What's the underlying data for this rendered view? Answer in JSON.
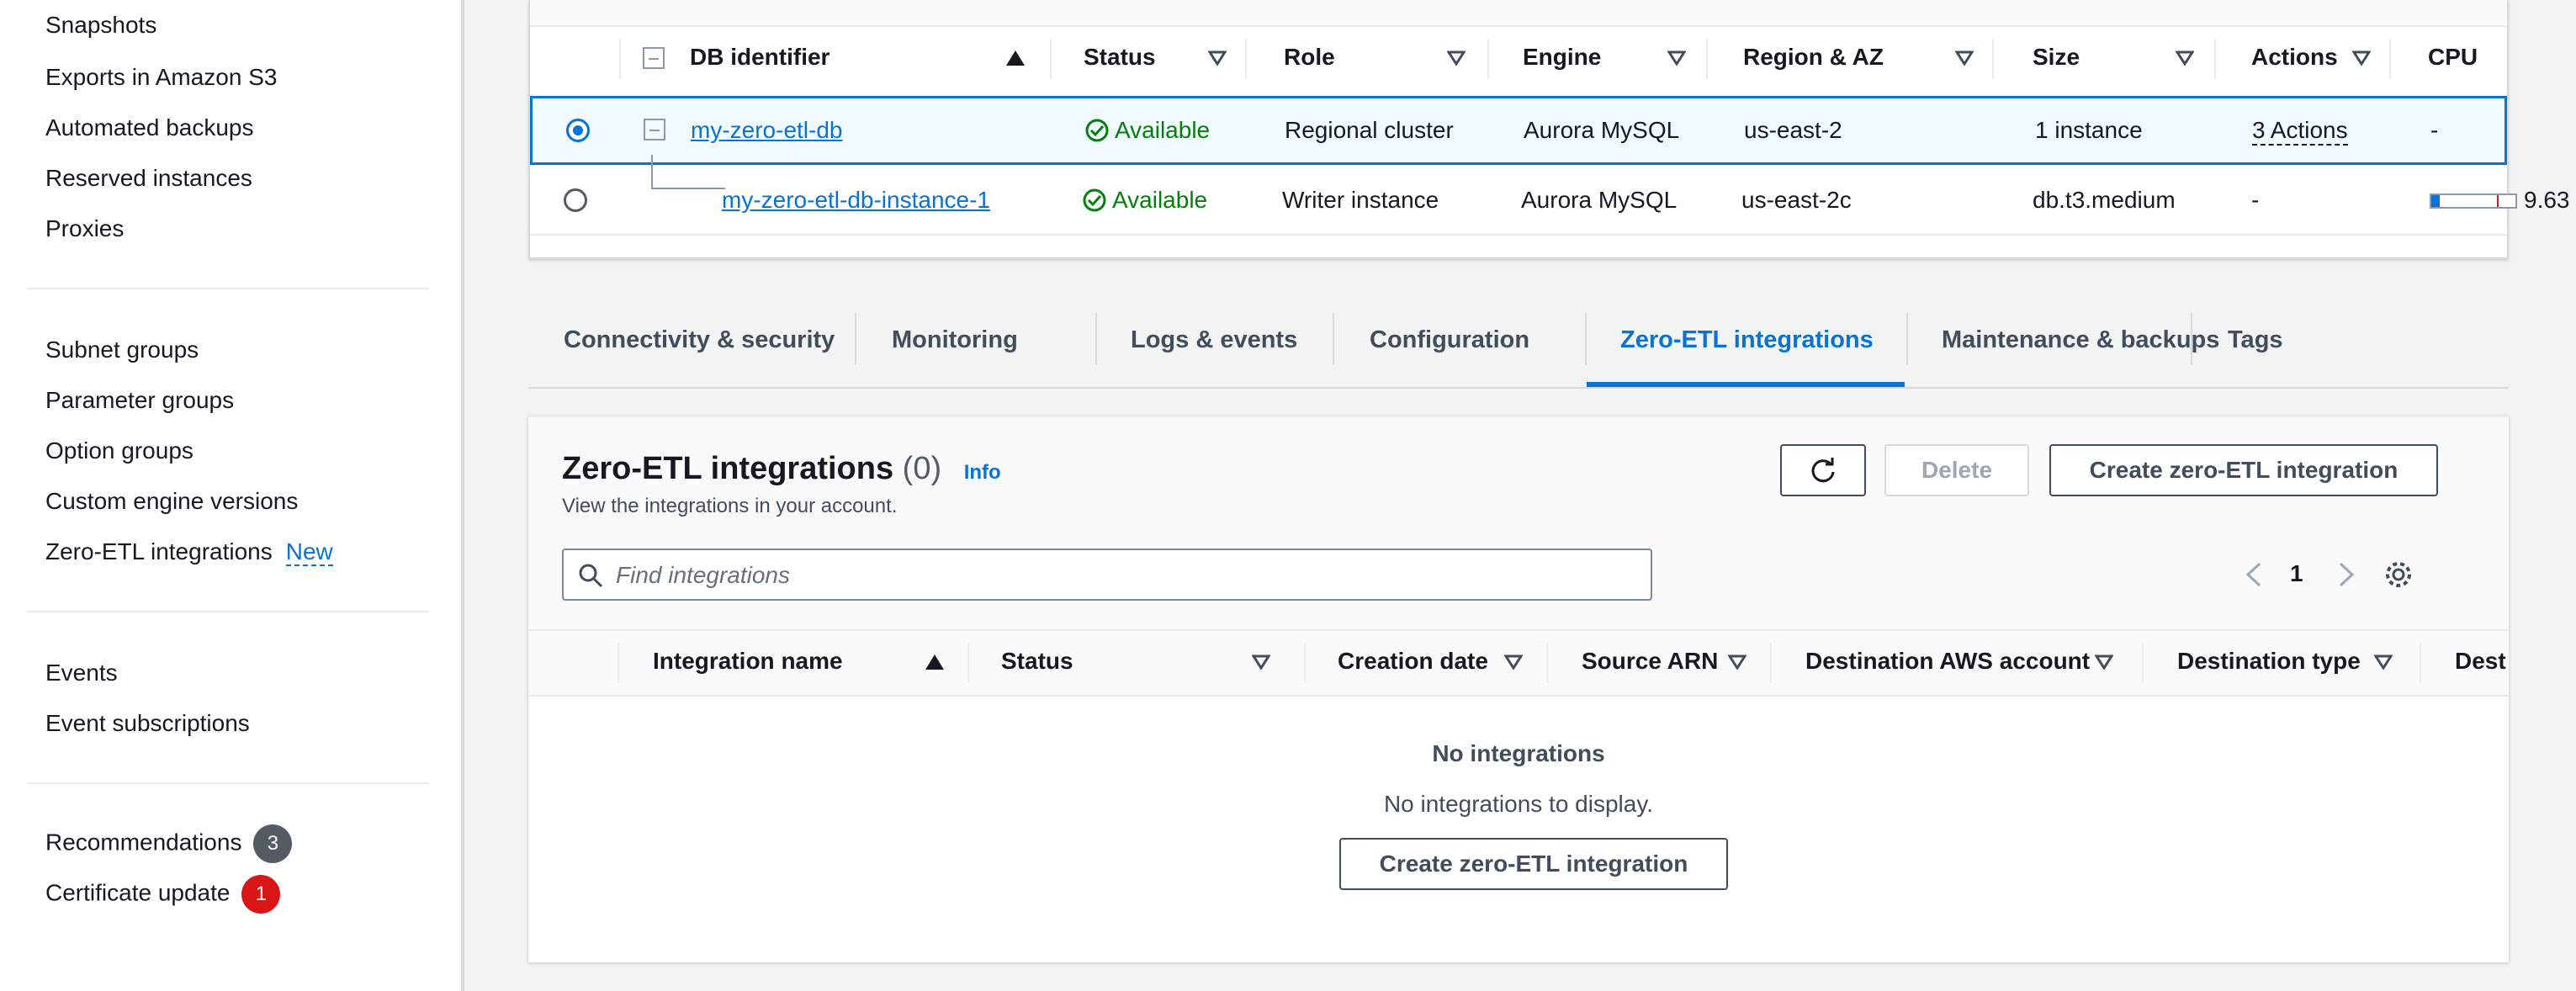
{
  "sidebar": {
    "group1": [
      "Snapshots",
      "Exports in Amazon S3",
      "Automated backups",
      "Reserved instances",
      "Proxies"
    ],
    "group2": [
      "Subnet groups",
      "Parameter groups",
      "Option groups",
      "Custom engine versions",
      "Zero-ETL integrations"
    ],
    "zero_etl_badge": "New",
    "group3": [
      "Events",
      "Event subscriptions"
    ],
    "recommendations": {
      "label": "Recommendations",
      "count": "3",
      "color": "#545b64"
    },
    "certificate_update": {
      "label": "Certificate update",
      "count": "1",
      "color": "#d91515"
    }
  },
  "db_table": {
    "columns": [
      "DB identifier",
      "Status",
      "Role",
      "Engine",
      "Region & AZ",
      "Size",
      "Actions",
      "CPU"
    ],
    "rows": [
      {
        "selected": true,
        "identifier": "my-zero-etl-db",
        "status": "Available",
        "role": "Regional cluster",
        "engine": "Aurora MySQL",
        "region": "us-east-2",
        "size": "1 instance",
        "actions": "3 Actions",
        "cpu": "-"
      },
      {
        "selected": false,
        "identifier": "my-zero-etl-db-instance-1",
        "status": "Available",
        "role": "Writer instance",
        "engine": "Aurora MySQL",
        "region": "us-east-2c",
        "size": "db.t3.medium",
        "actions": "-",
        "cpu": "9.63",
        "cpu_percent": 9.63
      }
    ]
  },
  "tabs": [
    "Connectivity & security",
    "Monitoring",
    "Logs & events",
    "Configuration",
    "Zero-ETL integrations",
    "Maintenance & backups",
    "Tags"
  ],
  "active_tab": "Zero-ETL integrations",
  "integrations": {
    "title": "Zero-ETL integrations",
    "count": "(0)",
    "info": "Info",
    "description": "View the integrations in your account.",
    "refresh_icon": "refresh-icon",
    "delete_label": "Delete",
    "create_label": "Create zero-ETL integration",
    "search_placeholder": "Find integrations",
    "page": "1",
    "columns": [
      "Integration name",
      "Status",
      "Creation date",
      "Source ARN",
      "Destination AWS account",
      "Destination type",
      "Destinatio"
    ],
    "empty_title": "No integrations",
    "empty_desc": "No integrations to display.",
    "empty_create_label": "Create zero-ETL integration"
  },
  "colors": {
    "accent": "#0972d3",
    "success": "#037f0c",
    "danger": "#d91515"
  }
}
